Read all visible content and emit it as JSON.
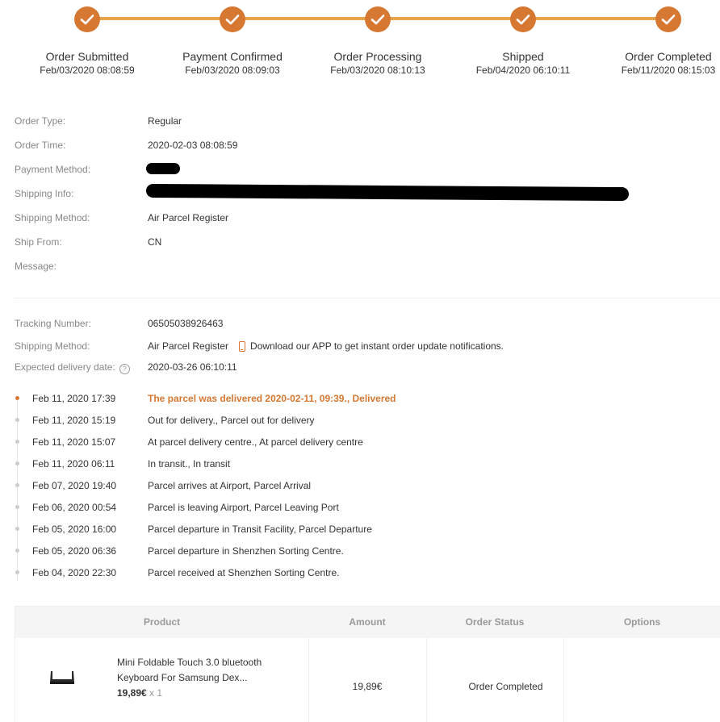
{
  "steps": [
    {
      "label": "Order Submitted",
      "time": "Feb/03/2020 08:08:59"
    },
    {
      "label": "Payment Confirmed",
      "time": "Feb/03/2020 08:09:03"
    },
    {
      "label": "Order Processing",
      "time": "Feb/03/2020 08:10:13"
    },
    {
      "label": "Shipped",
      "time": "Feb/04/2020 06:10:11"
    },
    {
      "label": "Order Completed",
      "time": "Feb/11/2020 08:15:03"
    }
  ],
  "order_info": {
    "order_type": {
      "label": "Order Type:",
      "value": "Regular"
    },
    "order_time": {
      "label": "Order Time:",
      "value": "2020-02-03 08:08:59"
    },
    "payment_method": {
      "label": "Payment Method:"
    },
    "shipping_info": {
      "label": "Shipping Info:"
    },
    "shipping_method": {
      "label": "Shipping Method:",
      "value": "Air Parcel Register"
    },
    "ship_from": {
      "label": "Ship From:",
      "value": "CN"
    },
    "message": {
      "label": "Message:",
      "value": ""
    }
  },
  "tracking": {
    "tracking_number": {
      "label": "Tracking Number:",
      "value": "06505038926463"
    },
    "shipping_method": {
      "label": "Shipping Method:",
      "value": "Air Parcel Register"
    },
    "app_notice": "Download our APP to get instant order update notifications.",
    "expected_delivery": {
      "label": "Expected delivery date:",
      "value": "2020-03-26 06:10:11",
      "help_icon": "?"
    }
  },
  "timeline": [
    {
      "date": "Feb 11, 2020 17:39",
      "desc": "The parcel was delivered 2020-02-11, 09:39., Delivered"
    },
    {
      "date": "Feb 11, 2020 15:19",
      "desc": "Out for delivery., Parcel out for delivery"
    },
    {
      "date": "Feb 11, 2020 15:07",
      "desc": "At parcel delivery centre., At parcel delivery centre"
    },
    {
      "date": "Feb 11, 2020 06:11",
      "desc": "In transit., In transit"
    },
    {
      "date": "Feb 07, 2020 19:40",
      "desc": "Parcel arrives at Airport, Parcel Arrival"
    },
    {
      "date": "Feb 06, 2020 00:54",
      "desc": "Parcel is leaving Airport, Parcel Leaving Port"
    },
    {
      "date": "Feb 05, 2020 16:00",
      "desc": "Parcel departure in Transit Facility, Parcel Departure"
    },
    {
      "date": "Feb 05, 2020 06:36",
      "desc": "Parcel departure in Shenzhen Sorting Centre."
    },
    {
      "date": "Feb 04, 2020 22:30",
      "desc": "Parcel received at Shenzhen Sorting Centre."
    }
  ],
  "table": {
    "headers": {
      "product": "Product",
      "amount": "Amount",
      "status": "Order Status",
      "options": "Options"
    },
    "rows": [
      {
        "name": "Mini Foldable Touch 3.0 bluetooth Keyboard For Samsung Dex...",
        "price": "19,89€",
        "qty": "x 1",
        "amount": "19,89€",
        "status": "Order Completed"
      }
    ]
  },
  "colors": {
    "accent": "#d67832",
    "progress_line": "#e7a24a",
    "label_gray": "#888888"
  }
}
